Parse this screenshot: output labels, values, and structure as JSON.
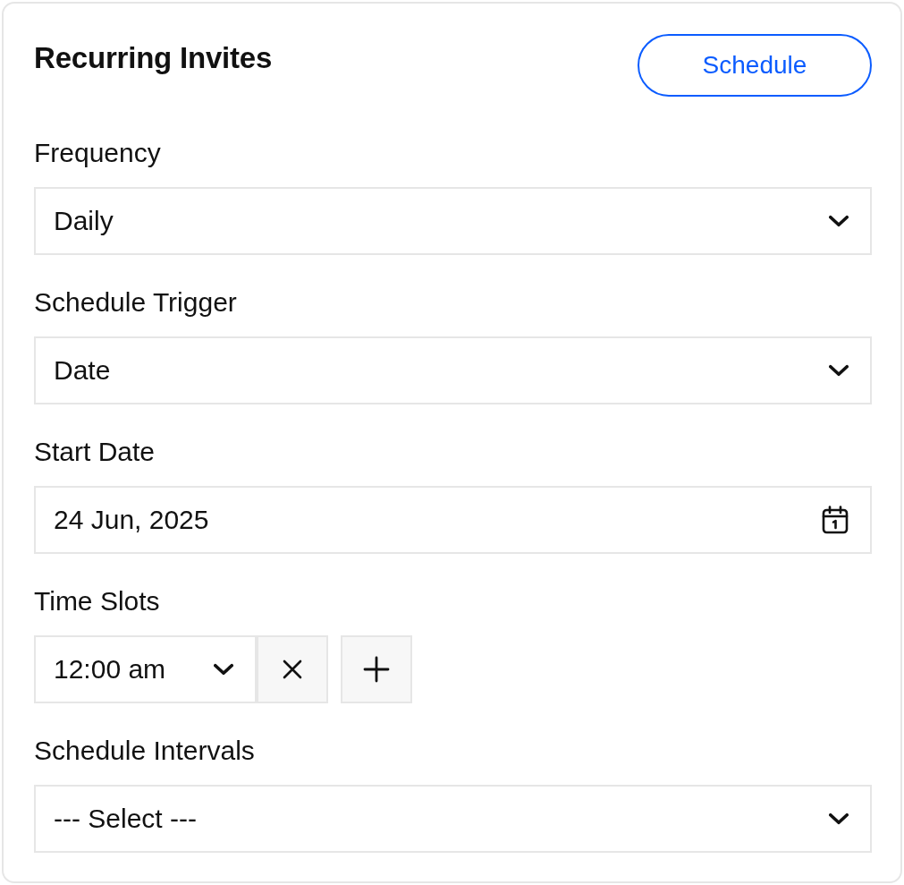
{
  "card": {
    "title": "Recurring Invites",
    "action": "Schedule"
  },
  "fields": [
    {
      "kind": "select",
      "label": "Frequency",
      "value": "Daily"
    },
    {
      "kind": "select",
      "label": "Schedule Trigger",
      "value": "Date"
    },
    {
      "kind": "date",
      "label": "Start Date",
      "value": "24 Jun, 2025"
    },
    {
      "kind": "time_slots",
      "label": "Time Slots",
      "slots": [
        {
          "value": "12:00 am"
        }
      ]
    },
    {
      "kind": "select",
      "label": "Schedule Intervals",
      "value": "--- Select ---"
    }
  ]
}
